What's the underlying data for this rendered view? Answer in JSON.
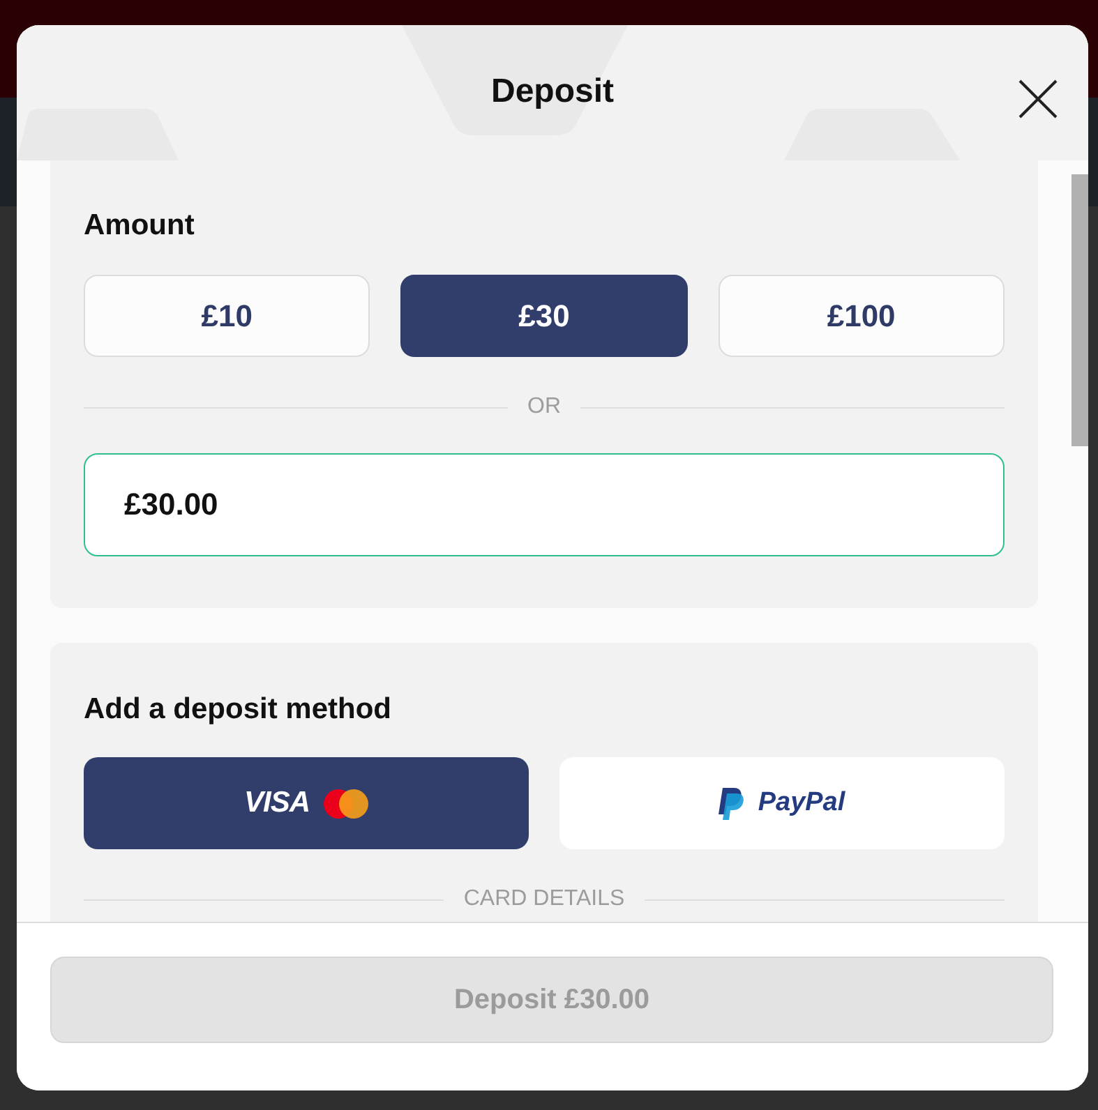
{
  "dialog": {
    "title": "Deposit"
  },
  "amount_section": {
    "heading": "Amount",
    "presets": [
      {
        "label": "£10",
        "selected": false
      },
      {
        "label": "£30",
        "selected": true
      },
      {
        "label": "£100",
        "selected": false
      }
    ],
    "divider": "OR",
    "input": {
      "value": "£30.00",
      "focused": true
    }
  },
  "method_section": {
    "heading": "Add a deposit method",
    "methods": [
      {
        "kind": "card",
        "label": "VISA",
        "selected": true
      },
      {
        "kind": "paypal",
        "label": "PayPal",
        "selected": false
      }
    ],
    "divider": "CARD DETAILS"
  },
  "footer": {
    "deposit_button": {
      "label": "Deposit £30.00",
      "disabled": true
    }
  }
}
